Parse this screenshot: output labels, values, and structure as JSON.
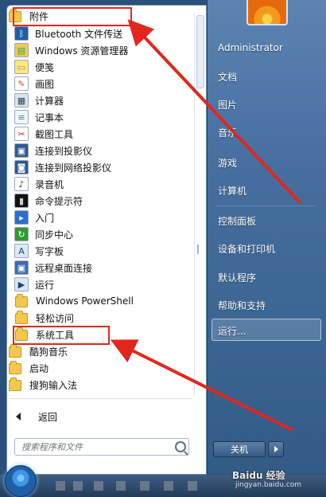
{
  "left": {
    "items": [
      {
        "label": "附件",
        "icon": "folder-icon",
        "level": 0
      },
      {
        "label": "Bluetooth 文件传送",
        "icon": "bluetooth-icon",
        "level": 1
      },
      {
        "label": "Windows 资源管理器",
        "icon": "explorer-icon",
        "level": 1
      },
      {
        "label": "便笺",
        "icon": "sticky-notes-icon",
        "level": 1
      },
      {
        "label": "画图",
        "icon": "paint-icon",
        "level": 1
      },
      {
        "label": "计算器",
        "icon": "calculator-icon",
        "level": 1
      },
      {
        "label": "记事本",
        "icon": "notepad-icon",
        "level": 1
      },
      {
        "label": "截图工具",
        "icon": "snipping-tool-icon",
        "level": 1
      },
      {
        "label": "连接到投影仪",
        "icon": "projector-icon",
        "level": 1
      },
      {
        "label": "连接到网络投影仪",
        "icon": "network-projector-icon",
        "level": 1
      },
      {
        "label": "录音机",
        "icon": "microphone-icon",
        "level": 1
      },
      {
        "label": "命令提示符",
        "icon": "command-prompt-icon",
        "level": 1
      },
      {
        "label": "入门",
        "icon": "getting-started-icon",
        "level": 1
      },
      {
        "label": "同步中心",
        "icon": "sync-center-icon",
        "level": 1
      },
      {
        "label": "写字板",
        "icon": "wordpad-icon",
        "level": 1
      },
      {
        "label": "远程桌面连接",
        "icon": "remote-desktop-icon",
        "level": 1
      },
      {
        "label": "运行",
        "icon": "run-icon",
        "level": 1
      },
      {
        "label": "Windows PowerShell",
        "icon": "folder-icon",
        "level": 1
      },
      {
        "label": "轻松访问",
        "icon": "folder-icon",
        "level": 1
      },
      {
        "label": "系统工具",
        "icon": "folder-icon",
        "level": 1
      },
      {
        "label": "酷狗音乐",
        "icon": "folder-icon",
        "level": 0
      },
      {
        "label": "启动",
        "icon": "folder-icon",
        "level": 0
      },
      {
        "label": "搜狗输入法",
        "icon": "folder-icon",
        "level": 0
      }
    ],
    "back_label": "返回",
    "search_placeholder": "搜索程序和文件"
  },
  "right": {
    "items": [
      {
        "label": "Administrator"
      },
      {
        "label": "文档"
      },
      {
        "label": "图片"
      },
      {
        "label": "音乐"
      },
      {
        "label": "游戏"
      },
      {
        "label": "计算机"
      },
      {
        "label": "控制面板"
      },
      {
        "label": "设备和打印机"
      },
      {
        "label": "默认程序"
      },
      {
        "label": "帮助和支持"
      },
      {
        "label": "运行..."
      }
    ],
    "shutdown_label": "关机"
  },
  "watermark": {
    "brand": "Baidu 经验",
    "url": "jingyan.baidu.com"
  },
  "colors": {
    "highlight": "#e1271d",
    "menu_right": "#466f9f",
    "folder": "#f4c74f"
  }
}
